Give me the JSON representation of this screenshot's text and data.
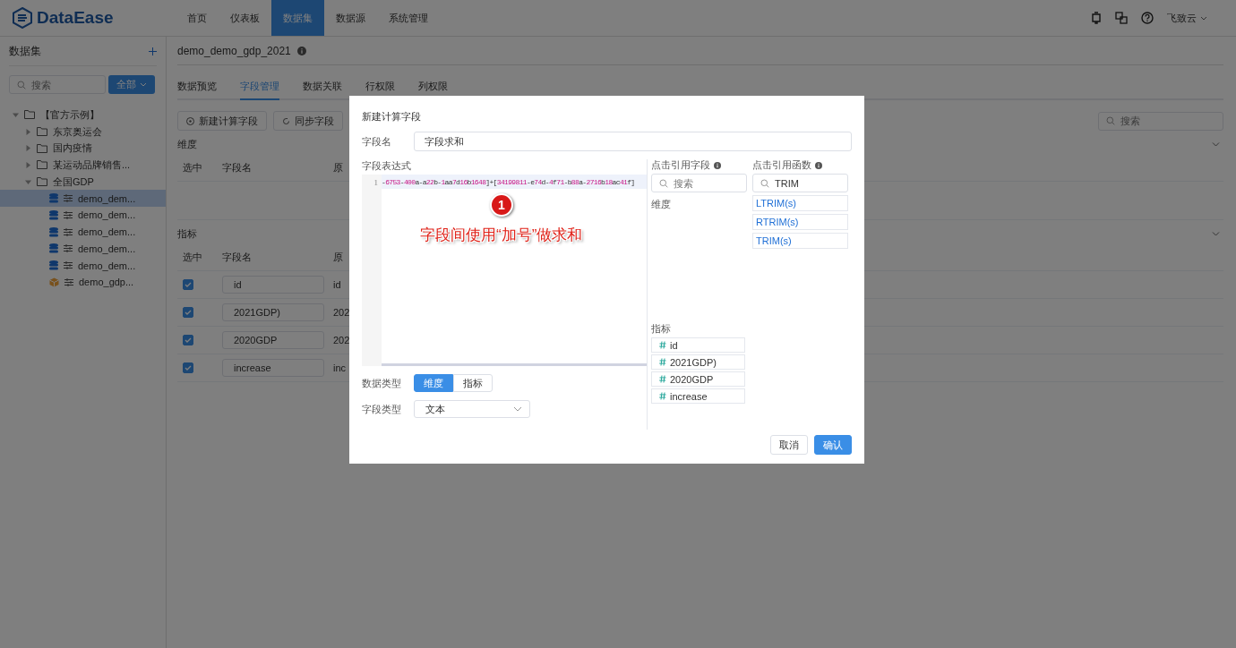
{
  "header": {
    "logo": "DataEase",
    "nav": [
      {
        "label": "首页",
        "selected": false
      },
      {
        "label": "仪表板",
        "selected": false
      },
      {
        "label": "数据集",
        "selected": true
      },
      {
        "label": "数据源",
        "selected": false
      },
      {
        "label": "系统管理",
        "selected": false
      }
    ],
    "user": "飞致云"
  },
  "sidebar": {
    "title": "数据集",
    "search": {
      "placeholder": "搜索"
    },
    "filter": "全部",
    "tree": [
      {
        "label": "【官方示例】",
        "kind": "folder",
        "expanded": true,
        "selected": false,
        "children": [
          {
            "label": "东京奥运会",
            "kind": "folder",
            "expanded": false,
            "selected": false
          },
          {
            "label": "国内疫情",
            "kind": "folder",
            "expanded": false,
            "selected": false
          },
          {
            "label": "某运动品牌销售...",
            "kind": "folder",
            "expanded": false,
            "selected": false
          },
          {
            "label": "全国GDP",
            "kind": "folder",
            "expanded": true,
            "selected": false,
            "children": [
              {
                "label": "demo_dem...",
                "kind": "db",
                "selected": true
              },
              {
                "label": "demo_dem...",
                "kind": "db",
                "selected": false
              },
              {
                "label": "demo_dem...",
                "kind": "db",
                "selected": false
              },
              {
                "label": "demo_dem...",
                "kind": "db",
                "selected": false
              },
              {
                "label": "demo_dem...",
                "kind": "db",
                "selected": false
              },
              {
                "label": "demo_gdp...",
                "kind": "excel",
                "selected": false
              }
            ]
          }
        ]
      }
    ]
  },
  "main": {
    "title": "demo_demo_gdp_2021",
    "tabs": [
      {
        "label": "数据预览",
        "selected": false
      },
      {
        "label": "字段管理",
        "selected": true
      },
      {
        "label": "数据关联",
        "selected": false
      },
      {
        "label": "行权限",
        "selected": false
      },
      {
        "label": "列权限",
        "selected": false
      }
    ],
    "buttons": [
      "新建计算字段",
      "同步字段"
    ],
    "search": {
      "placeholder": "搜索"
    },
    "dimension": {
      "title": "维度",
      "columns": [
        "选中",
        "字段名",
        "原"
      ]
    },
    "measure": {
      "title": "指标",
      "columns": [
        "选中",
        "字段名",
        "原"
      ],
      "rows": [
        {
          "checked": true,
          "name": "id",
          "column_3": "id"
        },
        {
          "checked": true,
          "name": "2021GDP)",
          "column_3": "202"
        },
        {
          "checked": true,
          "name": "2020GDP",
          "column_3": "202"
        },
        {
          "checked": true,
          "name": "increase",
          "column_3": "inc"
        }
      ]
    }
  },
  "dialog": {
    "title": "新建计算字段",
    "name_label": "字段名",
    "name_value": "字段求和",
    "expr_label": "字段表达式",
    "expr_lines": [
      {
        "number": "1",
        "code": "-6753-400a-a22b-1aa7d16b1648]+[34199811-e74d-4f71-b88a-2716b18ac41f]"
      }
    ],
    "fields_label": "点击引用字段",
    "fields_search": {
      "placeholder": "搜索"
    },
    "dim_label": "维度",
    "measure_label": "指标",
    "measures": [
      "id",
      "2021GDP)",
      "2020GDP",
      "increase"
    ],
    "funcs_label": "点击引用函数",
    "funcs_search": {
      "value": "TRIM"
    },
    "funcs": [
      "LTRIM(s)",
      "RTRIM(s)",
      "TRIM(s)"
    ],
    "data_type_label": "数据类型",
    "data_types": [
      {
        "label": "维度",
        "selected": true
      },
      {
        "label": "指标",
        "selected": false
      }
    ],
    "field_type_label": "字段类型",
    "field_type": "文本",
    "cancel": "取消",
    "ok": "确认"
  },
  "annotation": {
    "number": "1",
    "text": "字段间使用“加号”做求和"
  }
}
